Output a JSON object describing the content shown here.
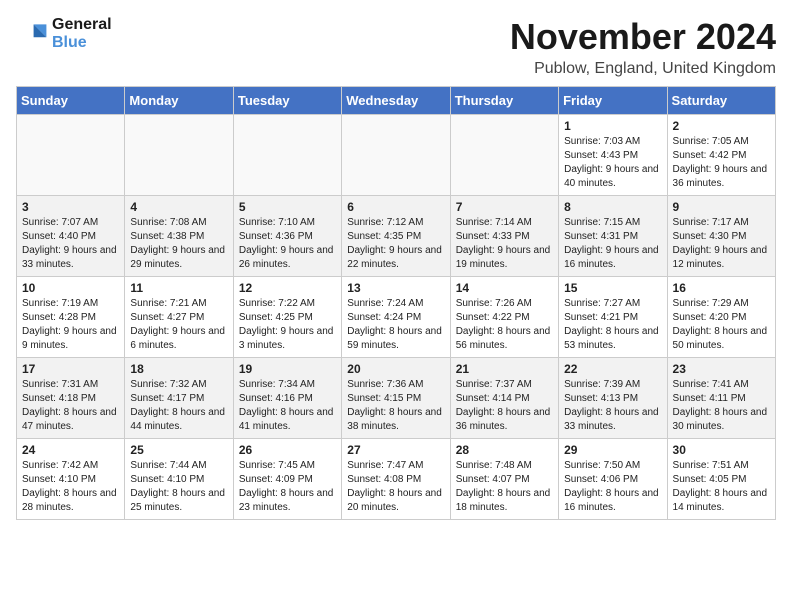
{
  "header": {
    "logo_line1": "General",
    "logo_line2": "Blue",
    "month": "November 2024",
    "location": "Publow, England, United Kingdom"
  },
  "weekdays": [
    "Sunday",
    "Monday",
    "Tuesday",
    "Wednesday",
    "Thursday",
    "Friday",
    "Saturday"
  ],
  "weeks": [
    [
      {
        "day": "",
        "info": ""
      },
      {
        "day": "",
        "info": ""
      },
      {
        "day": "",
        "info": ""
      },
      {
        "day": "",
        "info": ""
      },
      {
        "day": "",
        "info": ""
      },
      {
        "day": "1",
        "info": "Sunrise: 7:03 AM\nSunset: 4:43 PM\nDaylight: 9 hours and 40 minutes."
      },
      {
        "day": "2",
        "info": "Sunrise: 7:05 AM\nSunset: 4:42 PM\nDaylight: 9 hours and 36 minutes."
      }
    ],
    [
      {
        "day": "3",
        "info": "Sunrise: 7:07 AM\nSunset: 4:40 PM\nDaylight: 9 hours and 33 minutes."
      },
      {
        "day": "4",
        "info": "Sunrise: 7:08 AM\nSunset: 4:38 PM\nDaylight: 9 hours and 29 minutes."
      },
      {
        "day": "5",
        "info": "Sunrise: 7:10 AM\nSunset: 4:36 PM\nDaylight: 9 hours and 26 minutes."
      },
      {
        "day": "6",
        "info": "Sunrise: 7:12 AM\nSunset: 4:35 PM\nDaylight: 9 hours and 22 minutes."
      },
      {
        "day": "7",
        "info": "Sunrise: 7:14 AM\nSunset: 4:33 PM\nDaylight: 9 hours and 19 minutes."
      },
      {
        "day": "8",
        "info": "Sunrise: 7:15 AM\nSunset: 4:31 PM\nDaylight: 9 hours and 16 minutes."
      },
      {
        "day": "9",
        "info": "Sunrise: 7:17 AM\nSunset: 4:30 PM\nDaylight: 9 hours and 12 minutes."
      }
    ],
    [
      {
        "day": "10",
        "info": "Sunrise: 7:19 AM\nSunset: 4:28 PM\nDaylight: 9 hours and 9 minutes."
      },
      {
        "day": "11",
        "info": "Sunrise: 7:21 AM\nSunset: 4:27 PM\nDaylight: 9 hours and 6 minutes."
      },
      {
        "day": "12",
        "info": "Sunrise: 7:22 AM\nSunset: 4:25 PM\nDaylight: 9 hours and 3 minutes."
      },
      {
        "day": "13",
        "info": "Sunrise: 7:24 AM\nSunset: 4:24 PM\nDaylight: 8 hours and 59 minutes."
      },
      {
        "day": "14",
        "info": "Sunrise: 7:26 AM\nSunset: 4:22 PM\nDaylight: 8 hours and 56 minutes."
      },
      {
        "day": "15",
        "info": "Sunrise: 7:27 AM\nSunset: 4:21 PM\nDaylight: 8 hours and 53 minutes."
      },
      {
        "day": "16",
        "info": "Sunrise: 7:29 AM\nSunset: 4:20 PM\nDaylight: 8 hours and 50 minutes."
      }
    ],
    [
      {
        "day": "17",
        "info": "Sunrise: 7:31 AM\nSunset: 4:18 PM\nDaylight: 8 hours and 47 minutes."
      },
      {
        "day": "18",
        "info": "Sunrise: 7:32 AM\nSunset: 4:17 PM\nDaylight: 8 hours and 44 minutes."
      },
      {
        "day": "19",
        "info": "Sunrise: 7:34 AM\nSunset: 4:16 PM\nDaylight: 8 hours and 41 minutes."
      },
      {
        "day": "20",
        "info": "Sunrise: 7:36 AM\nSunset: 4:15 PM\nDaylight: 8 hours and 38 minutes."
      },
      {
        "day": "21",
        "info": "Sunrise: 7:37 AM\nSunset: 4:14 PM\nDaylight: 8 hours and 36 minutes."
      },
      {
        "day": "22",
        "info": "Sunrise: 7:39 AM\nSunset: 4:13 PM\nDaylight: 8 hours and 33 minutes."
      },
      {
        "day": "23",
        "info": "Sunrise: 7:41 AM\nSunset: 4:11 PM\nDaylight: 8 hours and 30 minutes."
      }
    ],
    [
      {
        "day": "24",
        "info": "Sunrise: 7:42 AM\nSunset: 4:10 PM\nDaylight: 8 hours and 28 minutes."
      },
      {
        "day": "25",
        "info": "Sunrise: 7:44 AM\nSunset: 4:10 PM\nDaylight: 8 hours and 25 minutes."
      },
      {
        "day": "26",
        "info": "Sunrise: 7:45 AM\nSunset: 4:09 PM\nDaylight: 8 hours and 23 minutes."
      },
      {
        "day": "27",
        "info": "Sunrise: 7:47 AM\nSunset: 4:08 PM\nDaylight: 8 hours and 20 minutes."
      },
      {
        "day": "28",
        "info": "Sunrise: 7:48 AM\nSunset: 4:07 PM\nDaylight: 8 hours and 18 minutes."
      },
      {
        "day": "29",
        "info": "Sunrise: 7:50 AM\nSunset: 4:06 PM\nDaylight: 8 hours and 16 minutes."
      },
      {
        "day": "30",
        "info": "Sunrise: 7:51 AM\nSunset: 4:05 PM\nDaylight: 8 hours and 14 minutes."
      }
    ]
  ]
}
